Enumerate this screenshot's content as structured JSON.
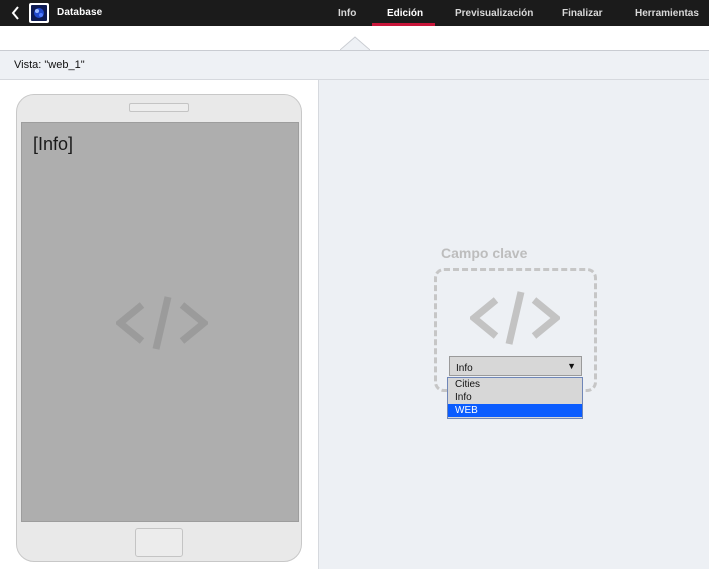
{
  "header": {
    "app_title": "Database",
    "logo_icon": "app-logo-icon",
    "back_icon": "chevron-left-icon",
    "tabs": [
      {
        "label": "Info",
        "active": false
      },
      {
        "label": "Edición",
        "active": true
      },
      {
        "label": "Previsualización",
        "active": false
      },
      {
        "label": "Finalizar",
        "active": false
      },
      {
        "label": "Herramientas",
        "active": false
      }
    ],
    "active_color": "#c8163a"
  },
  "view": {
    "label": "Vista: \"web_1\""
  },
  "preview": {
    "screen_text": "[Info]",
    "placeholder_icon": "code-brackets-icon"
  },
  "key_field": {
    "title": "Campo clave",
    "placeholder_icon": "code-brackets-icon",
    "selected_value": "Info",
    "options": [
      "Cities",
      "Info",
      "WEB"
    ],
    "highlighted_option": "WEB",
    "highlight_color": "#0a5cff"
  }
}
